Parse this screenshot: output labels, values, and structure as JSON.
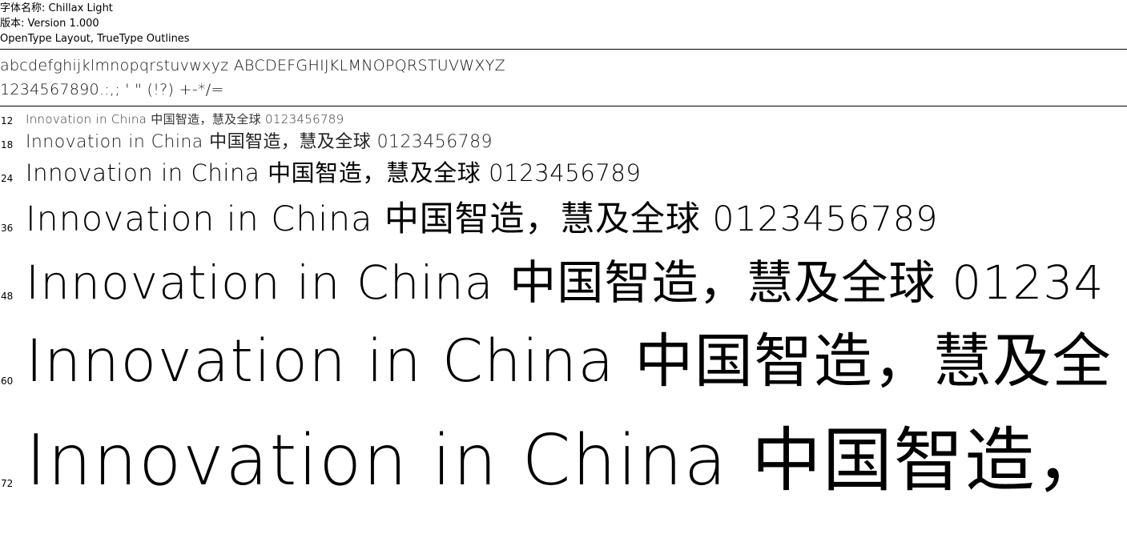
{
  "font_info": {
    "name_line": "字体名称: Chillax Light",
    "version_line": "版本: Version 1.000",
    "type_line": "OpenType Layout, TrueType Outlines"
  },
  "charset": {
    "letters": "abcdefghijklmnopqrstuvwxyz ABCDEFGHIJKLMNOPQRSTUVWXYZ",
    "digits_symbols": "1234567890.:,; ' \" (!?) +-*/="
  },
  "samples": [
    {
      "size": "12",
      "latin": "Innovation in China",
      "cjk": "中国智造，慧及全球",
      "digits": "0123456789"
    },
    {
      "size": "18",
      "latin": "Innovation in China",
      "cjk": "中国智造，慧及全球",
      "digits": "0123456789"
    },
    {
      "size": "24",
      "latin": "Innovation in China",
      "cjk": "中国智造，慧及全球",
      "digits": "0123456789"
    },
    {
      "size": "36",
      "latin": "Innovation in China",
      "cjk": "中国智造，慧及全球",
      "digits": "0123456789"
    },
    {
      "size": "48",
      "latin": "Innovation in China",
      "cjk": "中国智造，慧及全球",
      "digits": "01234"
    },
    {
      "size": "60",
      "latin": "Innovation in China",
      "cjk": "中国智造，慧及全",
      "digits": ""
    },
    {
      "size": "72",
      "latin": "Innovation in China",
      "cjk": "中国智造，",
      "digits": ""
    }
  ]
}
